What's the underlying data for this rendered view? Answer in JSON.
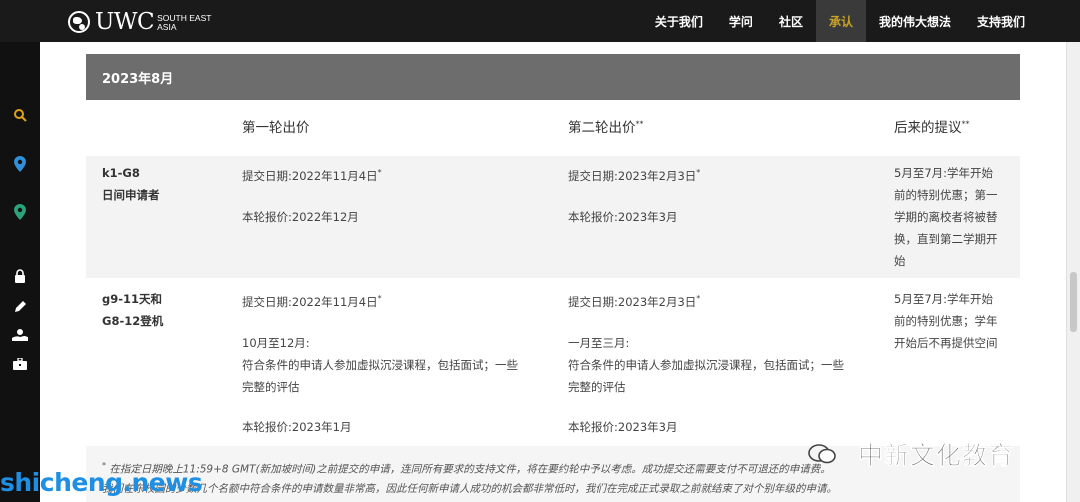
{
  "brand": {
    "name": "UWC",
    "sub": "SOUTH EAST\nASIA"
  },
  "nav": [
    {
      "label": "关于我们",
      "active": false
    },
    {
      "label": "学问",
      "active": false
    },
    {
      "label": "社区",
      "active": false
    },
    {
      "label": "承认",
      "active": true
    },
    {
      "label": "我的伟大想法",
      "active": false
    },
    {
      "label": "支持我们",
      "active": false
    }
  ],
  "sidebar_icons": [
    "search-icon",
    "map-pin-icon",
    "location-icon",
    "lock-icon",
    "pencil-icon",
    "donate-hand-icon",
    "briefcase-icon"
  ],
  "colors": {
    "accent": "#c9a227",
    "search": "#e0a21b",
    "pin_blue": "#2f8fd8",
    "pin_teal": "#2aa37a"
  },
  "table": {
    "group_title": "2023年8月",
    "headers": {
      "round1": "第一轮出价",
      "round2": "第二轮出价",
      "later": "后来的提议"
    },
    "header_marks": {
      "round2": "**",
      "later": "**"
    },
    "rows": [
      {
        "label_lines": [
          "k1-G8",
          "日间申请者"
        ],
        "r1_submit": "提交日期:2022年11月4日",
        "r1_price": "本轮报价:2022年12月",
        "r2_submit": "提交日期:2023年2月3日",
        "r2_price": "本轮报价:2023年3月",
        "later_lines": [
          "5月至7月:学年开始",
          "前的特别优惠；第一",
          "学期的离校者将被替",
          "换，直到第二学期开",
          "始"
        ]
      },
      {
        "label_lines": [
          "g9-11天和",
          "G8-12登机"
        ],
        "r1_submit": "提交日期:2022年11月4日",
        "r1_period": "10月至12月:",
        "r1_desc_lines": [
          "符合条件的申请人参加虚拟沉浸课程，包括面试；一些",
          "完整的评估"
        ],
        "r1_price": "本轮报价:2023年1月",
        "r2_submit": "提交日期:2023年2月3日",
        "r2_period": "一月至三月:",
        "r2_desc_lines": [
          "符合条件的申请人参加虚拟沉浸课程，包括面试；一些",
          "完整的评估"
        ],
        "r2_price": "本轮报价:2023年3月",
        "later_lines": [
          "5月至7月:学年开始",
          "前的特别优惠；学年",
          "开始后不再提供空间"
        ]
      }
    ],
    "star": "*"
  },
  "footnote": {
    "line1": "在指定日期晚上11:59+8 GMT(新加坡时间)之前提交的申请，连同所有要求的支持文件，将在要约轮中予以考虑。成功提交还需要支付不可退还的申请费。",
    "line2": "我们在东校园的少数几个名额中符合条件的申请数量非常高，因此任何新申请人成功的机会都非常低时，我们在完成正式录取之前就结束了对个别年级的申请。"
  },
  "watermarks": {
    "wechat": "中新文化教育",
    "site": "shicheng.news"
  }
}
